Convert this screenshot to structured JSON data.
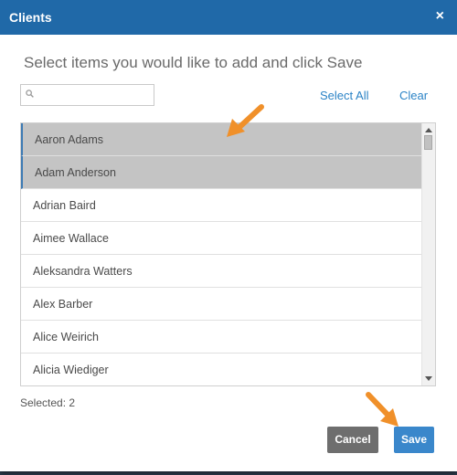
{
  "dialog": {
    "title": "Clients",
    "close_label": "×",
    "heading": "Select items you would like to add and click Save"
  },
  "search": {
    "value": "",
    "placeholder": ""
  },
  "actions": {
    "select_all": "Select All",
    "clear": "Clear"
  },
  "list": {
    "items": [
      {
        "label": "Aaron Adams",
        "selected": true
      },
      {
        "label": "Adam Anderson",
        "selected": true
      },
      {
        "label": "Adrian Baird",
        "selected": false
      },
      {
        "label": "Aimee Wallace",
        "selected": false
      },
      {
        "label": "Aleksandra Watters",
        "selected": false
      },
      {
        "label": "Alex Barber",
        "selected": false
      },
      {
        "label": "Alice Weirich",
        "selected": false
      },
      {
        "label": "Alicia Wiediger",
        "selected": false
      }
    ]
  },
  "footer": {
    "selected_text": "Selected: 2",
    "cancel_label": "Cancel",
    "save_label": "Save"
  },
  "colors": {
    "header": "#2069a8",
    "accent_link": "#2b83c6",
    "selected_row": "#c4c4c4",
    "cancel_button": "#6e6e6e",
    "save_button": "#3a87cb",
    "annotation_arrow": "#f0902a"
  },
  "icons": {
    "close": "close-icon",
    "search": "search-icon",
    "annotation": "arrow-icon"
  }
}
